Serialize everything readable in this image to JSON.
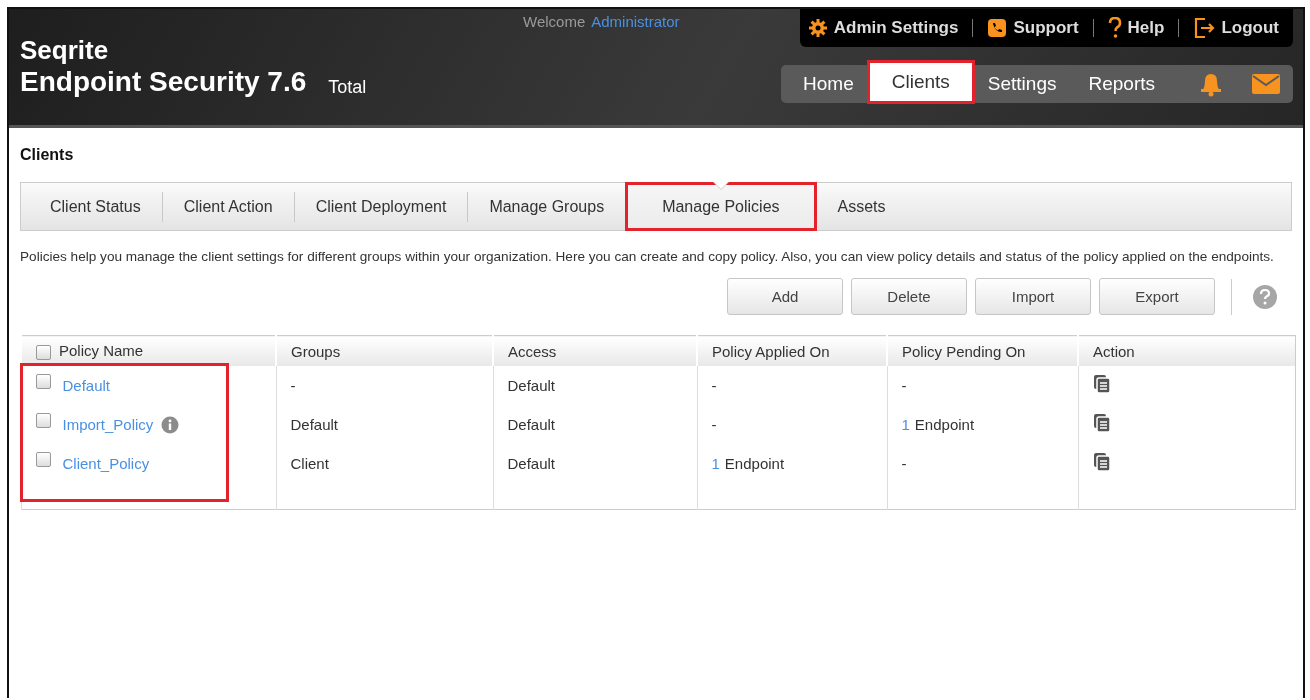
{
  "header": {
    "brand": "Seqrite",
    "product": "Endpoint Security 7.6",
    "edition": "Total",
    "welcome": "Welcome",
    "user": "Administrator",
    "top_links": [
      {
        "kind": "gear",
        "label": "Admin Settings"
      },
      {
        "kind": "phone",
        "label": "Support"
      },
      {
        "kind": "help",
        "label": "Help"
      },
      {
        "kind": "logout",
        "label": "Logout"
      }
    ],
    "nav": [
      {
        "label": "Home",
        "selected": false,
        "highlighted": false
      },
      {
        "label": "Clients",
        "selected": true,
        "highlighted": true
      },
      {
        "label": "Settings",
        "selected": false,
        "highlighted": false
      },
      {
        "label": "Reports",
        "selected": false,
        "highlighted": false
      }
    ],
    "nav_icons": [
      {
        "kind": "bell"
      },
      {
        "kind": "mail"
      }
    ]
  },
  "page_title": "Clients",
  "tabs": [
    {
      "label": "Client Status",
      "selected": false,
      "highlighted": false
    },
    {
      "label": "Client Action",
      "selected": false,
      "highlighted": false
    },
    {
      "label": "Client Deployment",
      "selected": false,
      "highlighted": false
    },
    {
      "label": "Manage Groups",
      "selected": false,
      "highlighted": false
    },
    {
      "label": "Manage Policies",
      "selected": true,
      "highlighted": true
    },
    {
      "label": "Assets",
      "selected": false,
      "highlighted": false
    }
  ],
  "description": "Policies help you manage the client settings for different groups within your organization. Here you can create and copy policy. Also, you can view policy details and status of the policy applied on the endpoints.",
  "buttons": [
    "Add",
    "Delete",
    "Import",
    "Export"
  ],
  "table": {
    "select_all_checked": false,
    "name_column_highlighted": true,
    "columns": [
      "Policy Name",
      "Groups",
      "Access",
      "Policy Applied On",
      "Policy Pending On",
      "Action"
    ],
    "rows": [
      {
        "checked": false,
        "name": "Default",
        "info": false,
        "groups": "-",
        "access": "Default",
        "applied_on": {
          "text": "-"
        },
        "pending_on": {
          "text": "-"
        }
      },
      {
        "checked": false,
        "name": "Import_Policy",
        "info": true,
        "groups": "Default",
        "access": "Default",
        "applied_on": {
          "text": "-"
        },
        "pending_on": {
          "count": "1",
          "text": "Endpoint"
        }
      },
      {
        "checked": false,
        "name": "Client_Policy",
        "info": false,
        "groups": "Client",
        "access": "Default",
        "applied_on": {
          "count": "1",
          "text": "Endpoint"
        },
        "pending_on": {
          "text": "-"
        }
      }
    ]
  }
}
